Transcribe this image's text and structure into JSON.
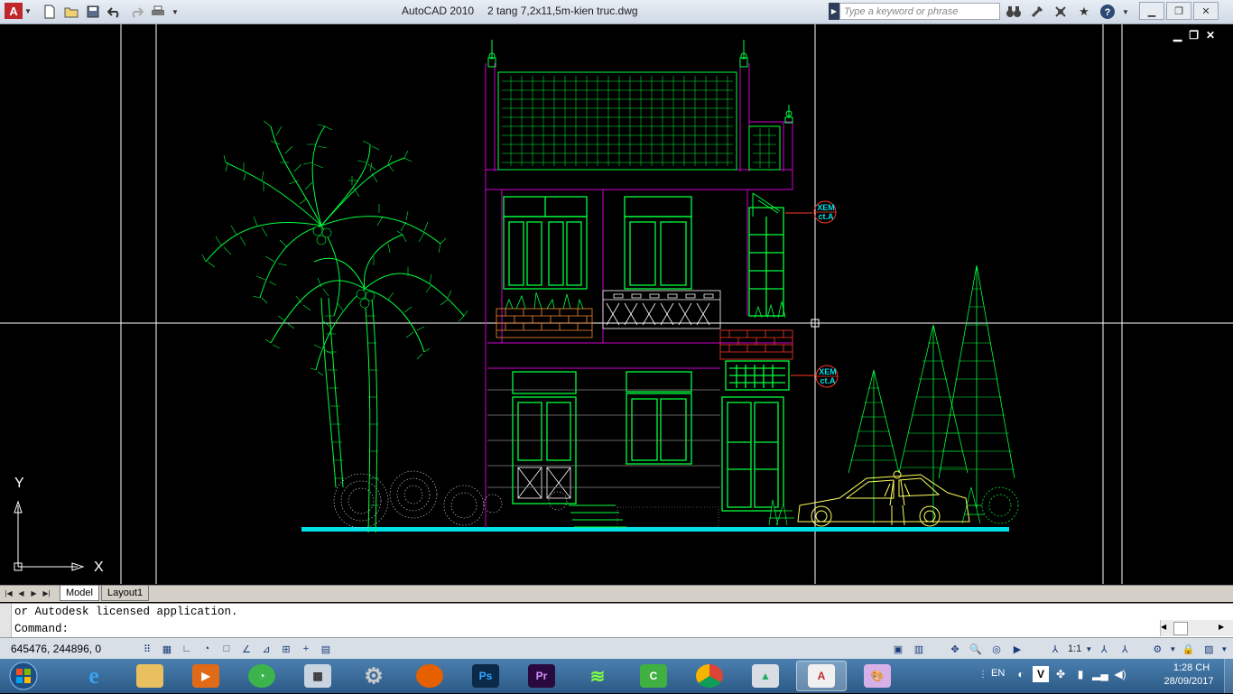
{
  "titlebar": {
    "app_title": "AutoCAD 2010",
    "file_title": "2 tang 7,2x11,5m-kien truc.dwg",
    "search_placeholder": "Type a keyword or phrase"
  },
  "quick_access": [
    "new-icon",
    "open-icon",
    "save-icon",
    "undo-icon",
    "redo-icon",
    "plot-icon"
  ],
  "drawing": {
    "callouts": [
      {
        "line1": "XEM",
        "line2": "ct.A"
      },
      {
        "line1": "XEM",
        "line2": "ct.A"
      }
    ],
    "ucs": {
      "x_label": "X",
      "y_label": "Y"
    },
    "colors": {
      "green": "#00ff3c",
      "magenta": "#d000d0",
      "cyan": "#00e0e8",
      "yellow": "#ffff60",
      "red": "#ff3a28",
      "orange": "#ff8a30",
      "white": "#ffffff"
    }
  },
  "tabs": [
    {
      "label": "Model",
      "active": true
    },
    {
      "label": "Layout1",
      "active": false
    }
  ],
  "command": {
    "line1": "or Autodesk licensed application.",
    "line2": "Command:"
  },
  "status": {
    "coordinates": "645476, 244896, 0",
    "annotation_scale": "1:1"
  },
  "taskbar": {
    "apps": [
      "windows-explorer-icon-ie",
      "folder",
      "media-player",
      "app-green",
      "calculator",
      "settings",
      "firefox",
      "photoshop",
      "premiere",
      "wifi-tool",
      "camtasia",
      "chrome",
      "autocad-alt",
      "autocad-2010",
      "paint"
    ],
    "app_labels": {
      "photoshop": "Ps",
      "premiere": "Pr"
    },
    "language": "EN",
    "time": "1:28 CH",
    "date": "28/09/2017"
  }
}
